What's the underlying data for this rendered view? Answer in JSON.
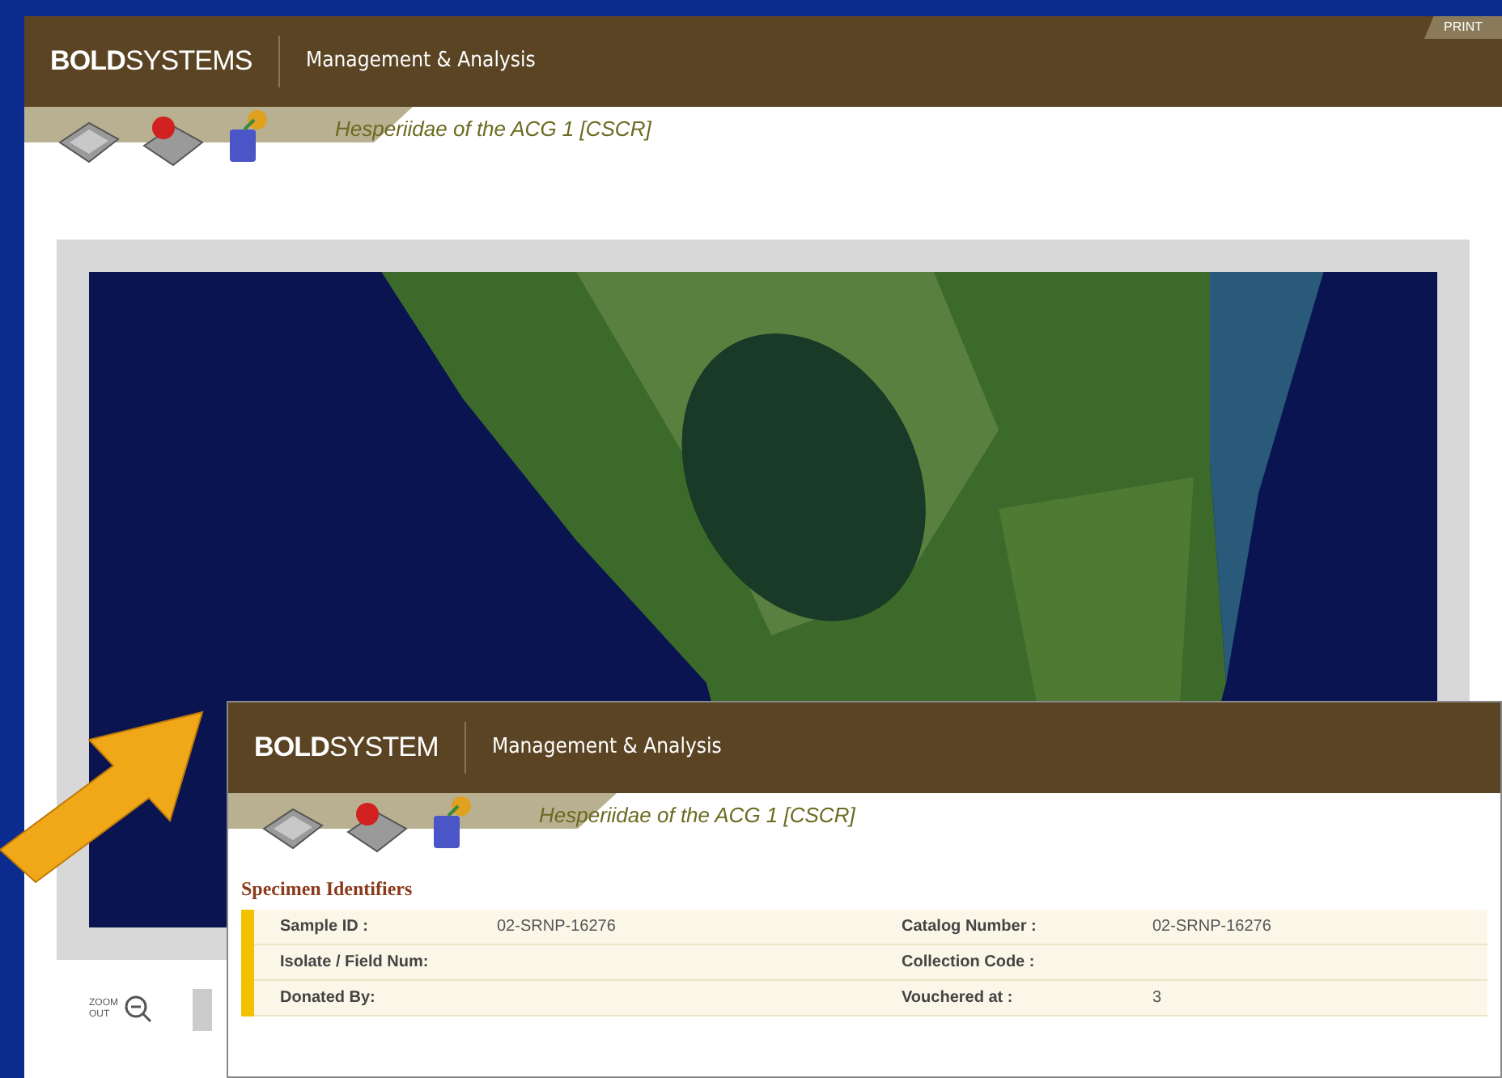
{
  "back_window": {
    "brand": "**BOLD**SYSTEMS",
    "section": "Management & Analysis",
    "print_tab": "PRINT",
    "project": "Hesperiidae of the ACG 1 [CSCR]",
    "zoom_label": "ZOOM OUT"
  },
  "front_window": {
    "brand": "**BOLD**SYSTEM",
    "section": "Management & Analysis",
    "project": "Hesperiidae of the ACG 1 [CSCR]",
    "heading": "Specimen Identifiers",
    "rows": [
      {
        "label": "Sample ID :",
        "value": "02-SRNP-16276",
        "label_2": "Catalog Number :",
        "value_2": "02-SRNP-16276"
      },
      {
        "label": "Isolate / Field Num:",
        "label_2": "Collection Code :"
      },
      {
        "label": "Donated By:",
        "label_2": "Vouchered at :",
        "value_2": "3"
      }
    ]
  }
}
